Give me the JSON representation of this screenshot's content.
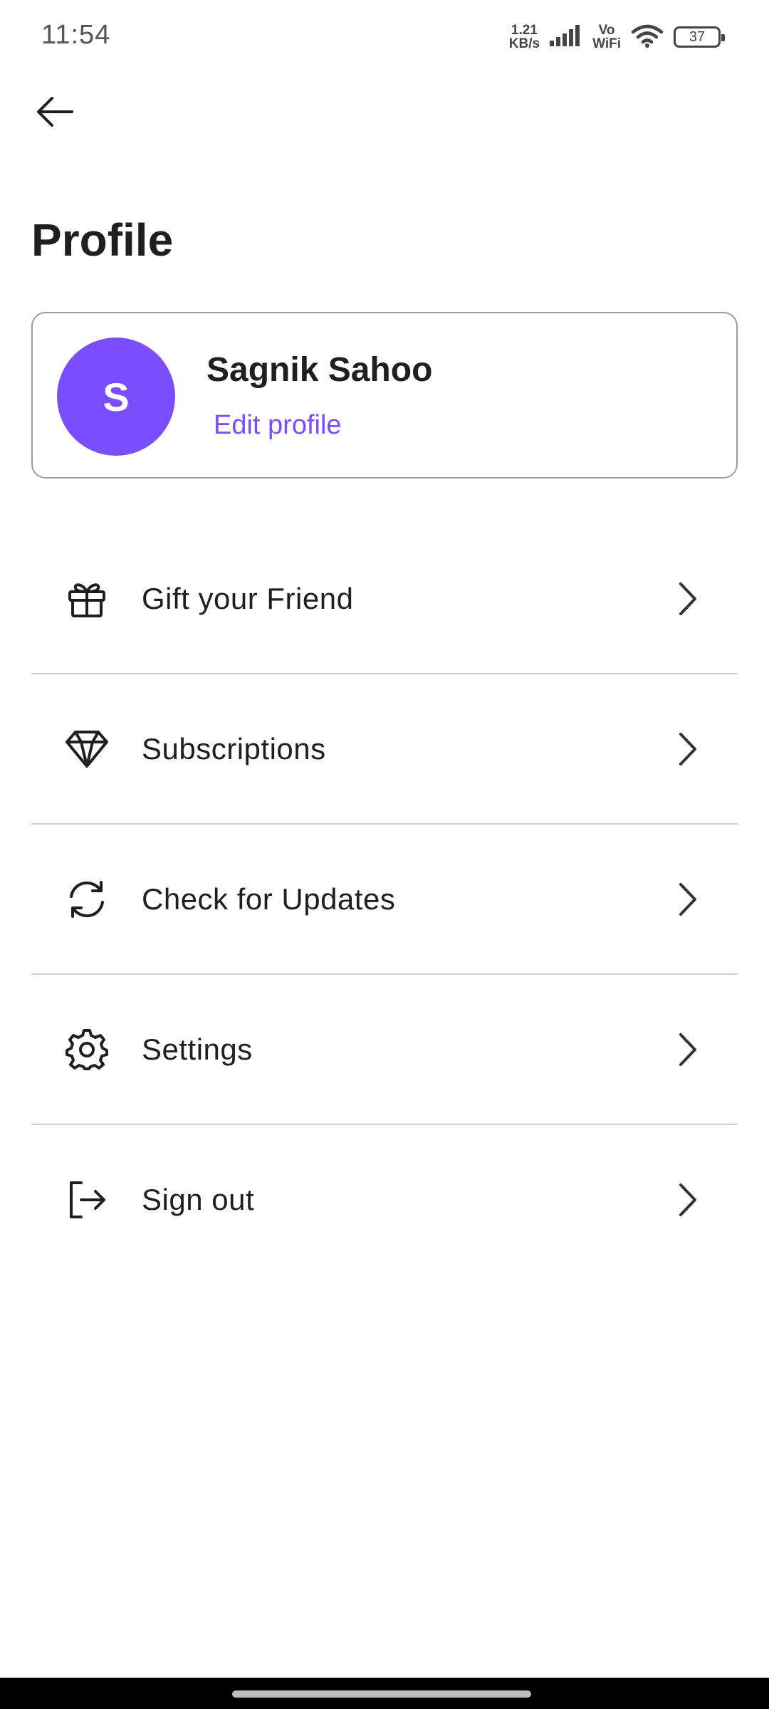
{
  "status_bar": {
    "time": "11:54",
    "net_speed_value": "1.21",
    "net_speed_unit": "KB/s",
    "vowifi_top": "Vo",
    "vowifi_bottom": "WiFi",
    "battery_level": "37",
    "icons": [
      "signal-icon",
      "wifi-icon",
      "battery-icon"
    ]
  },
  "header": {
    "back_icon": "arrow-left-icon",
    "title": "Profile"
  },
  "profile": {
    "avatar_initial": "S",
    "avatar_color": "#7a4dff",
    "name": "Sagnik Sahoo",
    "edit_label": "Edit profile",
    "accent_color": "#7a4dff"
  },
  "menu": {
    "items": [
      {
        "label": "Gift your Friend",
        "icon": "gift-icon"
      },
      {
        "label": "Subscriptions",
        "icon": "diamond-icon"
      },
      {
        "label": "Check for Updates",
        "icon": "refresh-icon"
      },
      {
        "label": "Settings",
        "icon": "gear-icon"
      },
      {
        "label": "Sign out",
        "icon": "sign-out-icon"
      }
    ],
    "chevron_icon": "chevron-right-icon"
  }
}
